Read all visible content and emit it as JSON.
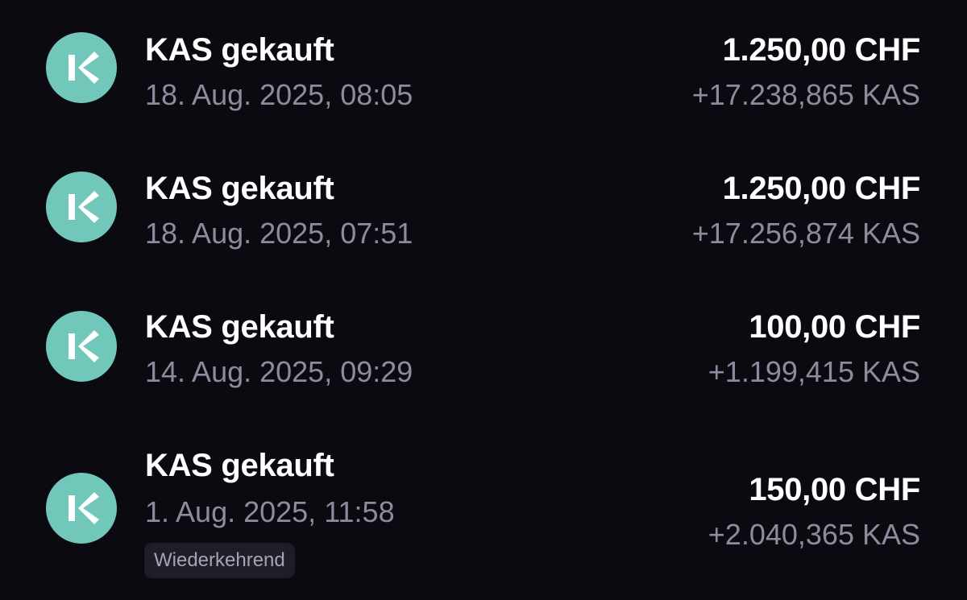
{
  "transactions": [
    {
      "icon": "kaspa-logo-icon",
      "title": "KAS gekauft",
      "date": "18. Aug. 2025, 08:05",
      "amount": "1.250,00 CHF",
      "crypto": "+17.238,865 KAS"
    },
    {
      "icon": "kaspa-logo-icon",
      "title": "KAS gekauft",
      "date": "18. Aug. 2025, 07:51",
      "amount": "1.250,00 CHF",
      "crypto": "+17.256,874 KAS"
    },
    {
      "icon": "kaspa-logo-icon",
      "title": "KAS gekauft",
      "date": "14. Aug. 2025, 09:29",
      "amount": "100,00 CHF",
      "crypto": "+1.199,415 KAS"
    },
    {
      "icon": "kaspa-logo-icon",
      "title": "KAS gekauft",
      "date": "1. Aug. 2025, 11:58",
      "amount": "150,00 CHF",
      "crypto": "+2.040,365 KAS",
      "badge": "Wiederkehrend"
    }
  ],
  "colors": {
    "background": "#0c0a11",
    "icon_bg": "#70c7ba",
    "primary_text": "#ffffff",
    "secondary_text": "#8f8a9d",
    "badge_bg": "#1f1d27"
  }
}
